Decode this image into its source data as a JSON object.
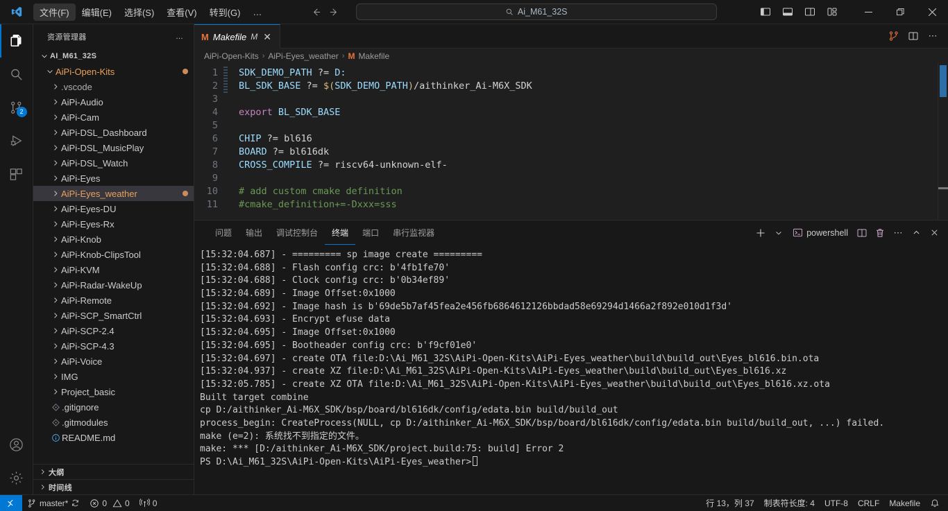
{
  "titlebar": {
    "menus": [
      {
        "label": "文件(F)",
        "active": true
      },
      {
        "label": "编辑(E)",
        "active": false
      },
      {
        "label": "选择(S)",
        "active": false
      },
      {
        "label": "查看(V)",
        "active": false
      },
      {
        "label": "转到(G)",
        "active": false
      }
    ],
    "more_label": "…",
    "search_value": "Ai_M61_32S",
    "back_title": "后退",
    "forward_title": "前进",
    "layout_icons": [
      "toggle-primary-sidebar",
      "toggle-panel",
      "toggle-secondary-sidebar",
      "customize-layout"
    ],
    "window_controls": {
      "minimize": "—",
      "maximize": "❐",
      "close": "✕"
    }
  },
  "activitybar": {
    "items": [
      {
        "name": "explorer",
        "label": "资源管理器",
        "active": true,
        "badge": null
      },
      {
        "name": "search",
        "label": "搜索",
        "active": false,
        "badge": null
      },
      {
        "name": "source-control",
        "label": "源代码管理",
        "active": false,
        "badge": "2"
      },
      {
        "name": "run-debug",
        "label": "运行和调试",
        "active": false,
        "badge": null
      },
      {
        "name": "extensions",
        "label": "扩展",
        "active": false,
        "badge": null
      }
    ],
    "bottom": [
      {
        "name": "accounts",
        "label": "帐户"
      },
      {
        "name": "settings",
        "label": "管理"
      }
    ]
  },
  "sidebar": {
    "title": "资源管理器",
    "more_label": "…",
    "tree": [
      {
        "label": "AI_M61_32S",
        "indent": 0,
        "type": "root",
        "expanded": true,
        "color": "normal",
        "dot": false
      },
      {
        "label": "AiPi-Open-Kits",
        "indent": 1,
        "type": "folder",
        "expanded": true,
        "color": "orange",
        "dot": true
      },
      {
        "label": ".vscode",
        "indent": 2,
        "type": "folder",
        "expanded": false,
        "color": "dim",
        "dot": false
      },
      {
        "label": "AiPi-Audio",
        "indent": 2,
        "type": "folder",
        "expanded": false,
        "color": "normal",
        "dot": false
      },
      {
        "label": "AiPi-Cam",
        "indent": 2,
        "type": "folder",
        "expanded": false,
        "color": "normal",
        "dot": false
      },
      {
        "label": "AiPi-DSL_Dashboard",
        "indent": 2,
        "type": "folder",
        "expanded": false,
        "color": "normal",
        "dot": false
      },
      {
        "label": "AiPi-DSL_MusicPlay",
        "indent": 2,
        "type": "folder",
        "expanded": false,
        "color": "normal",
        "dot": false
      },
      {
        "label": "AiPi-DSL_Watch",
        "indent": 2,
        "type": "folder",
        "expanded": false,
        "color": "normal",
        "dot": false
      },
      {
        "label": "AiPi-Eyes",
        "indent": 2,
        "type": "folder",
        "expanded": false,
        "color": "normal",
        "dot": false
      },
      {
        "label": "AiPi-Eyes_weather",
        "indent": 2,
        "type": "folder",
        "expanded": false,
        "color": "orange",
        "dot": true,
        "selected": true
      },
      {
        "label": "AiPi-Eyes-DU",
        "indent": 2,
        "type": "folder",
        "expanded": false,
        "color": "normal",
        "dot": false
      },
      {
        "label": "AiPi-Eyes-Rx",
        "indent": 2,
        "type": "folder",
        "expanded": false,
        "color": "normal",
        "dot": false
      },
      {
        "label": "AiPi-Knob",
        "indent": 2,
        "type": "folder",
        "expanded": false,
        "color": "normal",
        "dot": false
      },
      {
        "label": "AiPi-Knob-ClipsTool",
        "indent": 2,
        "type": "folder",
        "expanded": false,
        "color": "normal",
        "dot": false
      },
      {
        "label": "AiPi-KVM",
        "indent": 2,
        "type": "folder",
        "expanded": false,
        "color": "normal",
        "dot": false
      },
      {
        "label": "AiPi-Radar-WakeUp",
        "indent": 2,
        "type": "folder",
        "expanded": false,
        "color": "normal",
        "dot": false
      },
      {
        "label": "AiPi-Remote",
        "indent": 2,
        "type": "folder",
        "expanded": false,
        "color": "normal",
        "dot": false
      },
      {
        "label": "AiPi-SCP_SmartCtrl",
        "indent": 2,
        "type": "folder",
        "expanded": false,
        "color": "normal",
        "dot": false
      },
      {
        "label": "AiPi-SCP-2.4",
        "indent": 2,
        "type": "folder",
        "expanded": false,
        "color": "normal",
        "dot": false
      },
      {
        "label": "AiPi-SCP-4.3",
        "indent": 2,
        "type": "folder",
        "expanded": false,
        "color": "normal",
        "dot": false
      },
      {
        "label": "AiPi-Voice",
        "indent": 2,
        "type": "folder",
        "expanded": false,
        "color": "normal",
        "dot": false
      },
      {
        "label": "IMG",
        "indent": 2,
        "type": "folder",
        "expanded": false,
        "color": "normal",
        "dot": false
      },
      {
        "label": "Project_basic",
        "indent": 2,
        "type": "folder",
        "expanded": false,
        "color": "normal",
        "dot": false
      },
      {
        "label": ".gitignore",
        "indent": 2,
        "type": "file-git",
        "expanded": false,
        "color": "normal",
        "dot": false
      },
      {
        "label": ".gitmodules",
        "indent": 2,
        "type": "file-git",
        "expanded": false,
        "color": "normal",
        "dot": false
      },
      {
        "label": "README.md",
        "indent": 2,
        "type": "file-md",
        "expanded": false,
        "color": "normal",
        "dot": false
      }
    ],
    "sections": [
      {
        "label": "大纲",
        "expanded": false
      },
      {
        "label": "时间线",
        "expanded": false
      }
    ]
  },
  "editor": {
    "tab": {
      "icon": "M",
      "name": "Makefile",
      "dirty_badge": "M",
      "close": "✕"
    },
    "actions": [
      "compare-changes",
      "split-editor",
      "more-actions"
    ],
    "breadcrumb": [
      {
        "label": "AiPi-Open-Kits",
        "icon": null
      },
      {
        "label": "AiPi-Eyes_weather",
        "icon": null
      },
      {
        "label": "Makefile",
        "icon": "M"
      }
    ],
    "code_lines": [
      {
        "n": 1,
        "tokens": [
          {
            "t": "SDK_DEMO_PATH",
            "c": "var"
          },
          {
            "t": " ",
            "c": "plain"
          },
          {
            "t": "?=",
            "c": "op"
          },
          {
            "t": " ",
            "c": "plain"
          },
          {
            "t": "D:",
            "c": "val"
          }
        ]
      },
      {
        "n": 2,
        "tokens": [
          {
            "t": "BL_SDK_BASE",
            "c": "var"
          },
          {
            "t": " ",
            "c": "plain"
          },
          {
            "t": "?=",
            "c": "op"
          },
          {
            "t": " ",
            "c": "plain"
          },
          {
            "t": "$(",
            "c": "dollar"
          },
          {
            "t": "SDK_DEMO_PATH",
            "c": "var"
          },
          {
            "t": ")",
            "c": "dollar"
          },
          {
            "t": "/aithinker_Ai-M6X_SDK",
            "c": "plain"
          }
        ]
      },
      {
        "n": 3,
        "tokens": []
      },
      {
        "n": 4,
        "tokens": [
          {
            "t": "export",
            "c": "kw"
          },
          {
            "t": " ",
            "c": "plain"
          },
          {
            "t": "BL_SDK_BASE",
            "c": "var"
          }
        ]
      },
      {
        "n": 5,
        "tokens": []
      },
      {
        "n": 6,
        "tokens": [
          {
            "t": "CHIP",
            "c": "var"
          },
          {
            "t": " ",
            "c": "plain"
          },
          {
            "t": "?=",
            "c": "op"
          },
          {
            "t": " ",
            "c": "plain"
          },
          {
            "t": "bl616",
            "c": "plain"
          }
        ]
      },
      {
        "n": 7,
        "tokens": [
          {
            "t": "BOARD",
            "c": "var"
          },
          {
            "t": " ",
            "c": "plain"
          },
          {
            "t": "?=",
            "c": "op"
          },
          {
            "t": " ",
            "c": "plain"
          },
          {
            "t": "bl616dk",
            "c": "plain"
          }
        ]
      },
      {
        "n": 8,
        "tokens": [
          {
            "t": "CROSS_COMPILE",
            "c": "var"
          },
          {
            "t": " ",
            "c": "plain"
          },
          {
            "t": "?=",
            "c": "op"
          },
          {
            "t": " ",
            "c": "plain"
          },
          {
            "t": "riscv64-unknown-elf-",
            "c": "plain"
          }
        ]
      },
      {
        "n": 9,
        "tokens": []
      },
      {
        "n": 10,
        "tokens": [
          {
            "t": "# add custom cmake definition",
            "c": "comment"
          }
        ]
      },
      {
        "n": 11,
        "tokens": [
          {
            "t": "#cmake_definition+=-Dxxx=sss",
            "c": "comment"
          }
        ]
      }
    ]
  },
  "panel": {
    "tabs": [
      {
        "label": "问题",
        "active": false
      },
      {
        "label": "输出",
        "active": false
      },
      {
        "label": "调试控制台",
        "active": false
      },
      {
        "label": "终端",
        "active": true
      },
      {
        "label": "端口",
        "active": false
      },
      {
        "label": "串行监视器",
        "active": false
      }
    ],
    "actions": {
      "new_terminal": "+",
      "split_dropdown": "⌄",
      "shell_name": "powershell",
      "split_terminal": "split-editor",
      "kill_terminal": "trash",
      "more": "…",
      "maximize": "chevron-up",
      "close": "✕"
    },
    "terminal_lines": [
      "[15:32:04.687] - ========= sp image create =========",
      "[15:32:04.688] - Flash config crc: b'4fb1fe70'",
      "[15:32:04.688] - Clock config crc: b'0b34ef89'",
      "[15:32:04.689] - Image Offset:0x1000",
      "[15:32:04.692] - Image hash is b'69de5b7af45fea2e456fb6864612126bbdad58e69294d1466a2f892e010d1f3d'",
      "[15:32:04.693] - Encrypt efuse data",
      "[15:32:04.695] - Image Offset:0x1000",
      "[15:32:04.695] - Bootheader config crc: b'f9cf01e0'",
      "[15:32:04.697] - create OTA file:D:\\Ai_M61_32S\\AiPi-Open-Kits\\AiPi-Eyes_weather\\build\\build_out\\Eyes_bl616.bin.ota",
      "[15:32:04.937] - create XZ file:D:\\Ai_M61_32S\\AiPi-Open-Kits\\AiPi-Eyes_weather\\build\\build_out\\Eyes_bl616.xz",
      "[15:32:05.785] - create XZ OTA file:D:\\Ai_M61_32S\\AiPi-Open-Kits\\AiPi-Eyes_weather\\build\\build_out\\Eyes_bl616.xz.ota",
      "Built target combine",
      "cp D:/aithinker_Ai-M6X_SDK/bsp/board/bl616dk/config/edata.bin build/build_out",
      "process_begin: CreateProcess(NULL, cp D:/aithinker_Ai-M6X_SDK/bsp/board/bl616dk/config/edata.bin build/build_out, ...) failed.",
      "make (e=2): 系统找不到指定的文件。",
      "make: *** [D:/aithinker_Ai-M6X_SDK/project.build:75: build] Error 2"
    ],
    "prompt": "PS D:\\Ai_M61_32S\\AiPi-Open-Kits\\AiPi-Eyes_weather>"
  },
  "statusbar": {
    "remote_icon": "remote-window",
    "branch": "master*",
    "sync_icon": "sync",
    "errors": "0",
    "warnings": "0",
    "ports": "0",
    "cursor_position": "行 13，列 37",
    "indentation": "制表符长度: 4",
    "encoding": "UTF-8",
    "eol": "CRLF",
    "language": "Makefile",
    "bell_icon": "bell"
  },
  "colors": {
    "accent": "#0078d4",
    "folder_highlight": "#e8a15d",
    "modified_dot": "#cb8c5b",
    "makefile_icon": "#e8743b",
    "comment": "#6a9955",
    "variable": "#9cdcfe",
    "keyword": "#c586c0"
  }
}
